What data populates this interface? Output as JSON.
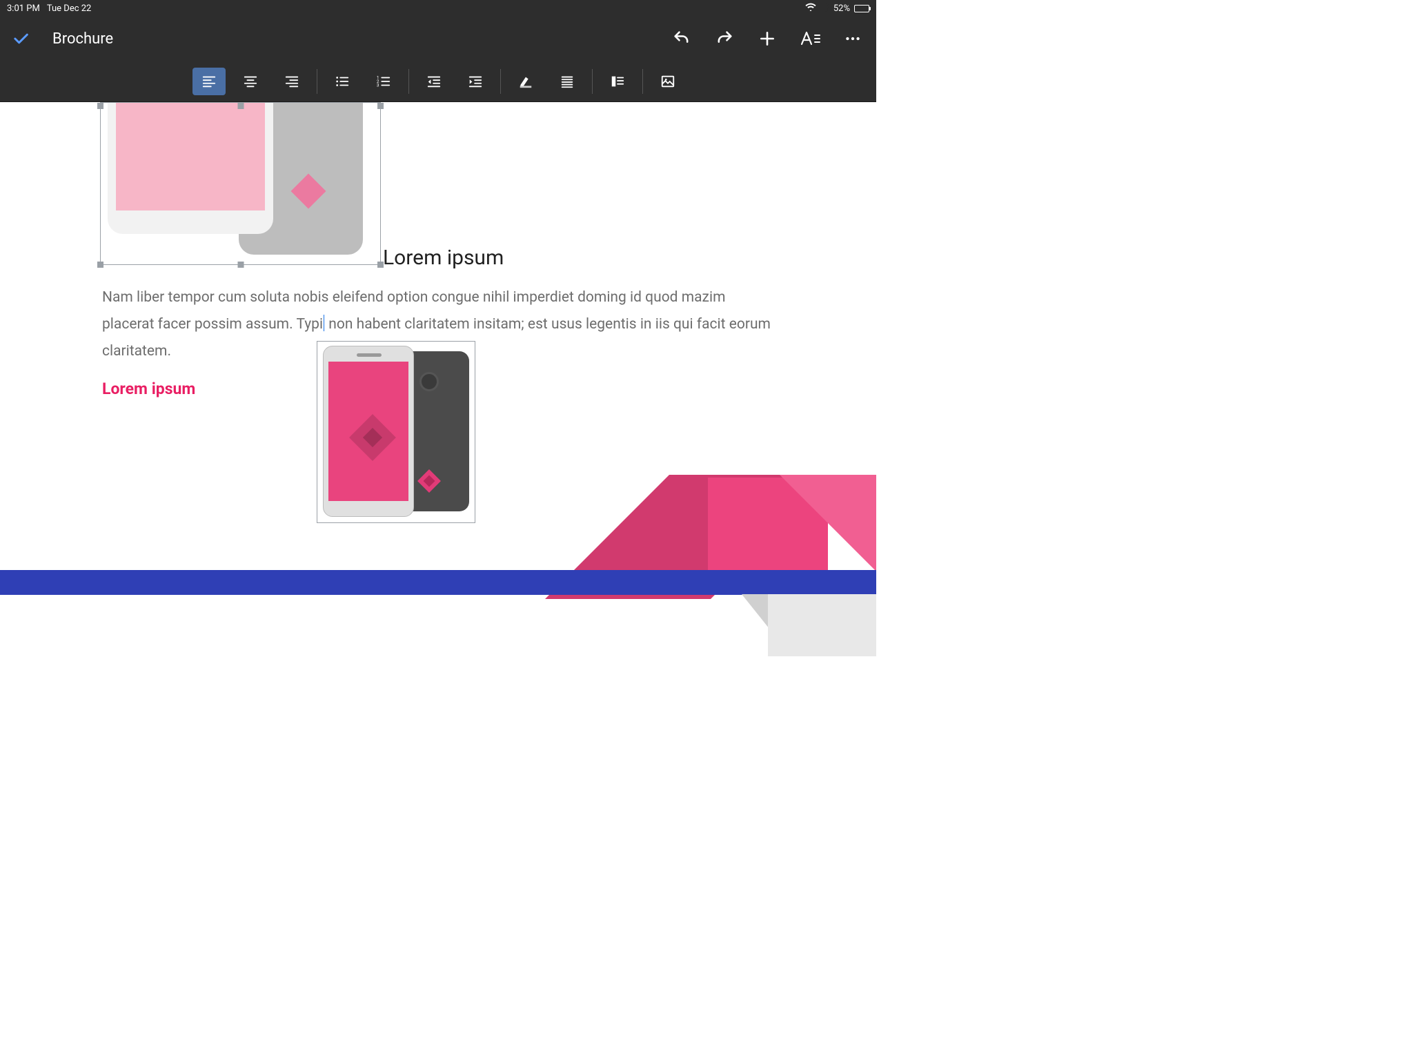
{
  "status": {
    "time": "3:01 PM",
    "date": "Tue Dec 22",
    "battery_pct": "52%"
  },
  "header": {
    "doc_title": "Brochure"
  },
  "document": {
    "heading": "Lorem ipsum",
    "body_before_cursor": "Nam liber tempor cum soluta nobis eleifend option congue nihil imperdiet doming id quod mazim placerat facer possim assum. Typi",
    "body_after_cursor": " non habent claritatem insitam; est usus legentis in iis qui facit eorum claritatem.",
    "subheading": "Lorem ipsum"
  },
  "colors": {
    "accent_pink": "#e91e63",
    "brand_blue": "#2f3fb5",
    "toolbar_bg": "#2d2d2d",
    "active_tool": "#4a6fa5"
  }
}
